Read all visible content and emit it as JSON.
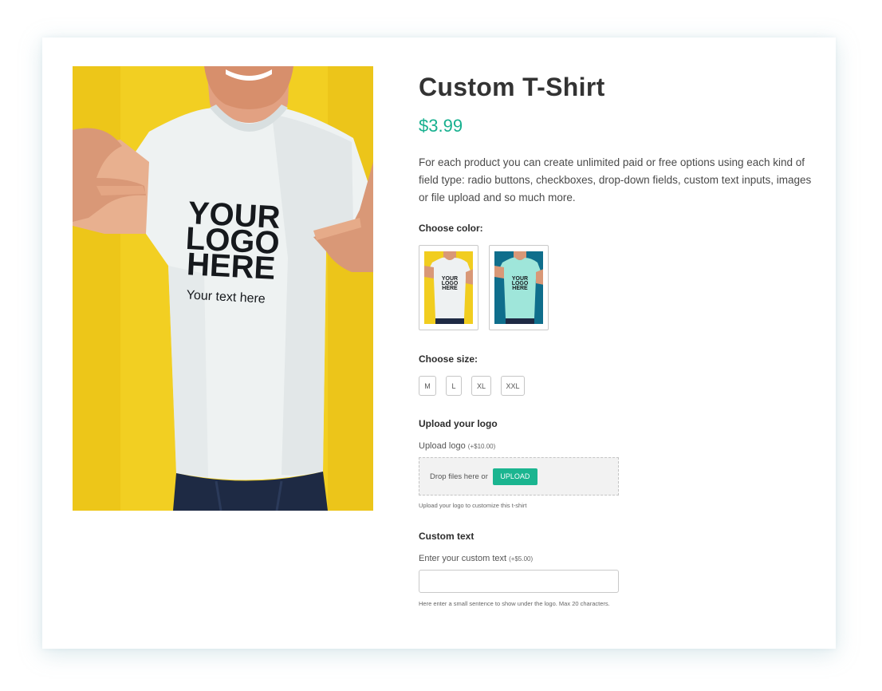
{
  "product": {
    "title": "Custom T-Shirt",
    "price": "$3.99",
    "description": "For each product you can create unlimited paid or free options using each kind of field type: radio buttons, checkboxes, drop-down fields, custom text inputs, images or file upload and so much more.",
    "image": {
      "print_line1": "YOUR",
      "print_line2": "LOGO",
      "print_line3": "HERE",
      "print_subtext": "Your text here"
    }
  },
  "color_option": {
    "label": "Choose color:",
    "swatches": [
      {
        "name": "white",
        "background": "#f1cd1f",
        "shirt": "#eef1f2"
      },
      {
        "name": "mint",
        "background": "#0f6e8c",
        "shirt": "#9fe6da"
      }
    ],
    "thumb_print": {
      "line1": "YOUR",
      "line2": "LOGO",
      "line3": "HERE"
    }
  },
  "size_option": {
    "label": "Choose size:",
    "sizes": [
      "M",
      "L",
      "XL",
      "XXL"
    ]
  },
  "logo_upload": {
    "section_title": "Upload your logo",
    "field_label": "Upload logo",
    "field_price": "(+$10.00)",
    "drop_text": "Drop files here or",
    "button_label": "UPLOAD",
    "hint": "Upload your logo to customize this t-shirt"
  },
  "custom_text": {
    "section_title": "Custom text",
    "field_label": "Enter your custom text",
    "field_price": "(+$5.00)",
    "value": "",
    "hint": "Here enter a small sentence to show under the logo. Max 20 characters."
  },
  "colors": {
    "accent": "#17b08f",
    "button": "#1bb590",
    "title": "#333333"
  }
}
